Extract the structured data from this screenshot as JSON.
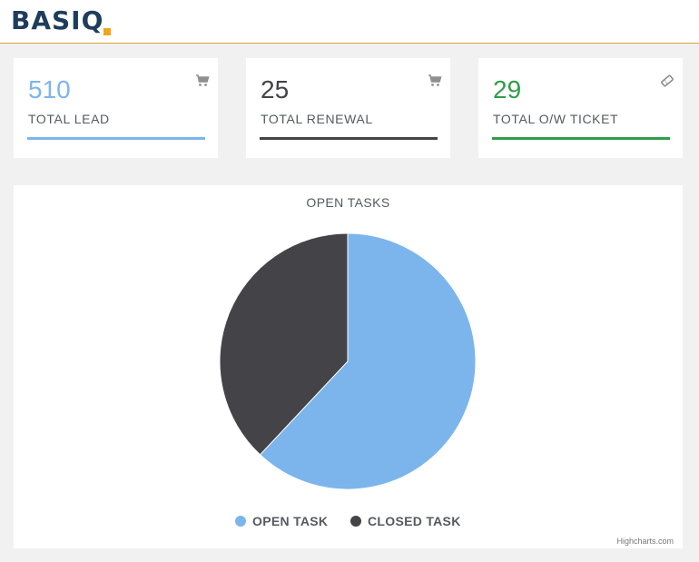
{
  "brand": {
    "name": "BASIQ",
    "accent": "#f2a51a",
    "primary": "#1e3d5c"
  },
  "cards": [
    {
      "value": "510",
      "label": "TOTAL LEAD",
      "color": "#7cb5ec",
      "icon": "shopping-cart-icon"
    },
    {
      "value": "25",
      "label": "TOTAL RENEWAL",
      "color": "#434348",
      "icon": "shopping-cart-icon"
    },
    {
      "value": "29",
      "label": "TOTAL O/W TICKET",
      "color": "#2e9e48",
      "icon": "ticket-icon"
    }
  ],
  "chart": {
    "title": "OPEN TASKS",
    "credits": "Highcharts.com"
  },
  "chart_data": {
    "type": "pie",
    "title": "OPEN TASKS",
    "series": [
      {
        "name": "OPEN TASK",
        "value": 62,
        "color": "#7cb5ec"
      },
      {
        "name": "CLOSED TASK",
        "value": 38,
        "color": "#434348"
      }
    ],
    "legend_position": "bottom-center"
  }
}
